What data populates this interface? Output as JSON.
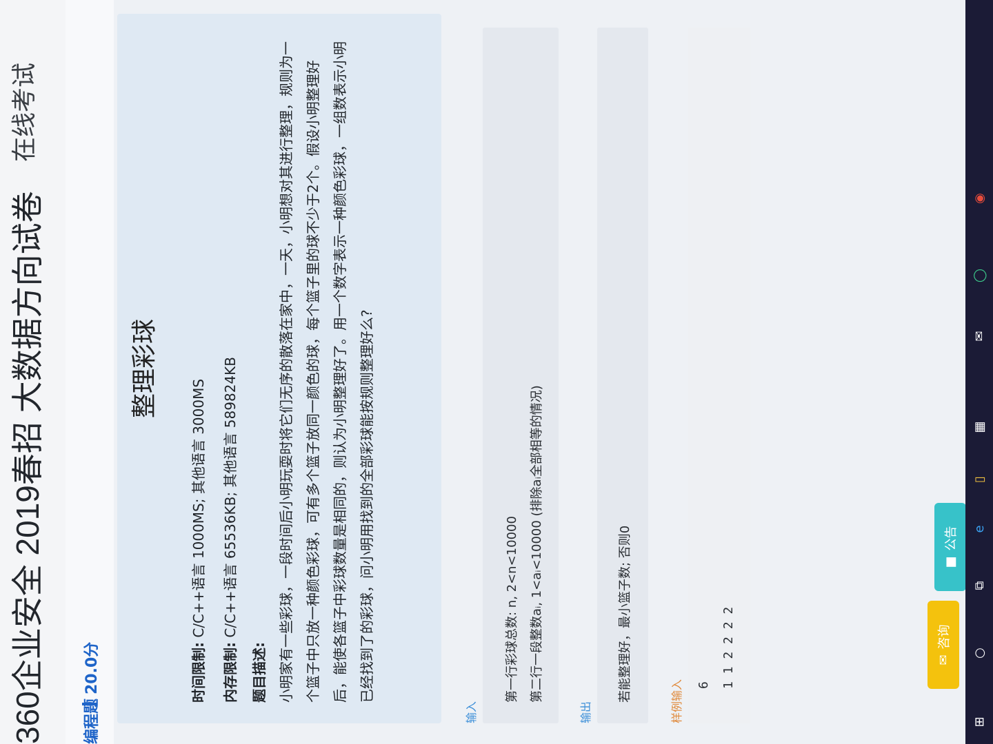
{
  "header": {
    "title": "360企业安全 2019春招 大数据方向试卷",
    "mode": "在线考试"
  },
  "subheader": {
    "qtype": "编程题",
    "score": "20.0分"
  },
  "problem": {
    "title": "整理彩球",
    "time_limit_label": "时间限制:",
    "time_limit_value": "C/C++语言 1000MS; 其他语言 3000MS",
    "memory_limit_label": "内存限制:",
    "memory_limit_value": "C/C++语言 65536KB; 其他语言 589824KB",
    "desc_label": "题目描述:",
    "description": "小明家有一些彩球，一段时间后小明玩耍时将它们无序的散落在家中，一天，小明想对其进行整理，规则为一个篮子中只放一种颜色彩球，可有多个篮子放同一颜色的球，每个篮子里的球不少于2个。假设小明整理好后，能使各篮子中彩球数量是相同的，则认为小明整理好了。用一个数字表示一种颜色彩球，一组数表示小明已经找到了的彩球，问小明用找到的全部彩球能按规则整理好么?"
  },
  "input_section": {
    "label": "输入",
    "line1": "第一行彩球总数: n, 2<n<10000",
    "line2": "第二行一段整数aᵢ, 1<aᵢ<10000 (排除aᵢ全部相等的情况)"
  },
  "output_section": {
    "label": "输出",
    "line1": "若能整理好，最小篮子数; 否则0"
  },
  "sample": {
    "label": "样例输入",
    "line1": "6",
    "line2": "1 1 2 2 2 2"
  },
  "buttons": {
    "consult": "咨询",
    "notice": "公告"
  },
  "colors": {
    "accent": "#1e64c8",
    "consult": "#f4c20d",
    "notice": "#37c2c9",
    "taskbar": "#1b1b36"
  },
  "taskbar": {
    "icons": [
      "windows-start-icon",
      "search-icon",
      "task-view-icon",
      "edge-icon",
      "file-explorer-icon",
      "store-icon",
      "mail-icon",
      "loading-app-icon",
      "chrome-icon"
    ]
  }
}
